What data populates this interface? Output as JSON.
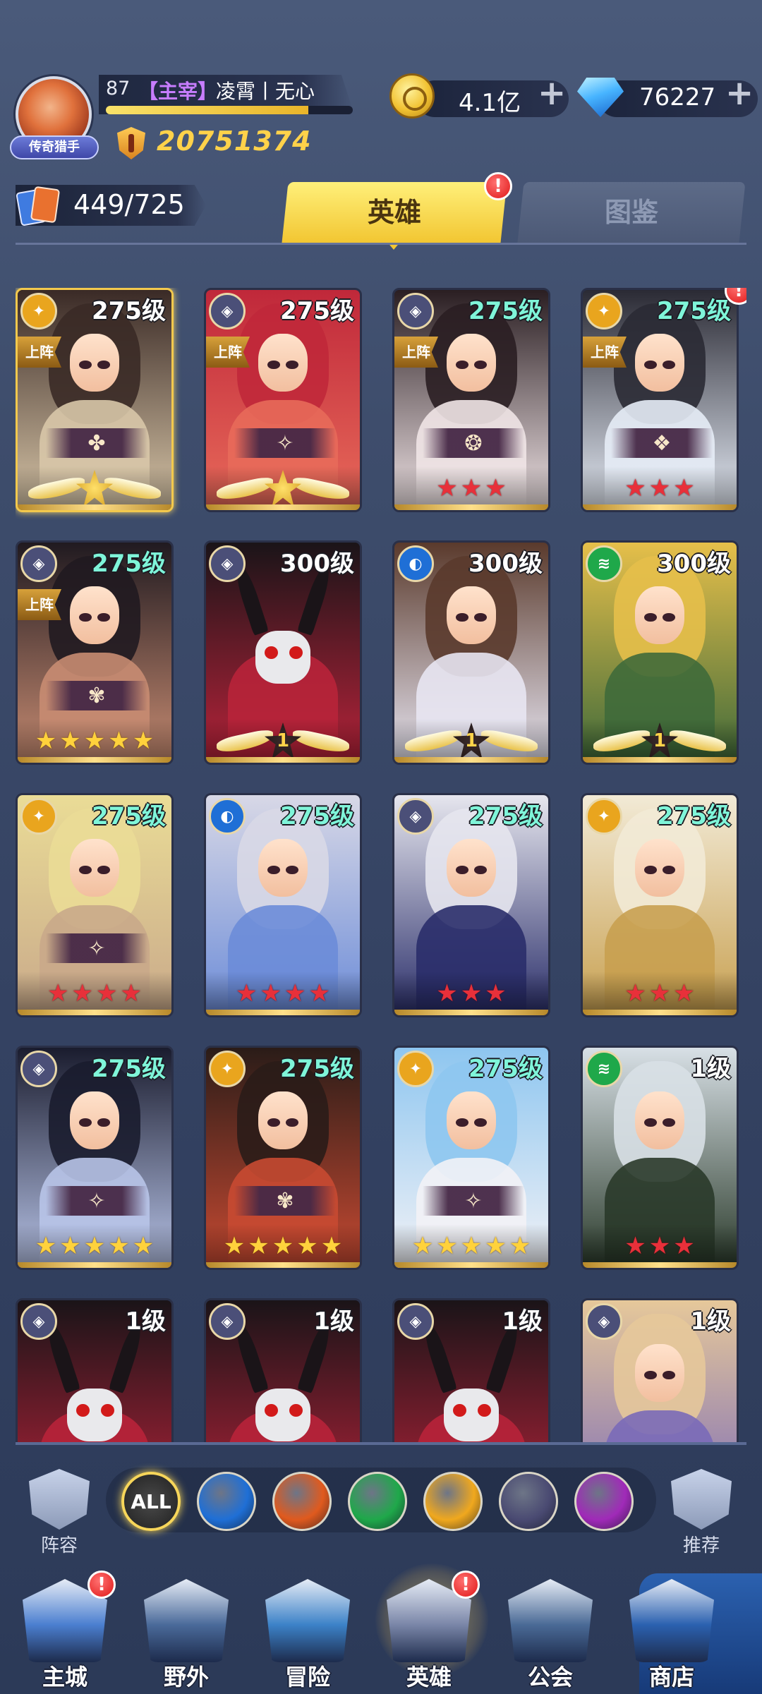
{
  "player": {
    "level": "87",
    "role": "【主宰】",
    "name": "凌霄丨无心",
    "title_badge": "传奇猎手",
    "power": "20751374",
    "exp_fraction": 0.82
  },
  "resources": {
    "gold": "4.1亿",
    "diamonds": "76227"
  },
  "collection": {
    "count": "449/725"
  },
  "tabs": {
    "heroes": "英雄",
    "codex": "图鉴",
    "alert": "!"
  },
  "heroes": [
    {
      "level": "275级",
      "faction": "light",
      "deployed": "上阵",
      "rating": "wing",
      "wing_num": "",
      "emblem": "✤",
      "level_color": "white",
      "colors": [
        "#3a2a26",
        "#d8c6a8"
      ],
      "gold_frame": true
    },
    {
      "level": "275级",
      "faction": "void",
      "deployed": "上阵",
      "rating": "wing",
      "wing_num": "",
      "emblem": "✧",
      "level_color": "white",
      "colors": [
        "#c0283a",
        "#e86a5a"
      ],
      "gold_frame": false
    },
    {
      "level": "275级",
      "faction": "void",
      "deployed": "上阵",
      "rating": "stars",
      "stars": 3,
      "star_color": "red",
      "emblem": "❂",
      "level_color": "teal",
      "colors": [
        "#2a1e22",
        "#f0e4e6"
      ],
      "gold_frame": false
    },
    {
      "level": "275级",
      "faction": "light",
      "deployed": "上阵",
      "rating": "stars",
      "stars": 3,
      "star_color": "red",
      "emblem": "❖",
      "level_color": "teal",
      "colors": [
        "#2a2a34",
        "#e6ecf6"
      ],
      "gold_frame": false,
      "alert": "!"
    },
    {
      "level": "275级",
      "faction": "void",
      "deployed": "上阵",
      "rating": "stars",
      "stars": 5,
      "star_color": "gold",
      "emblem": "✾",
      "level_color": "teal",
      "colors": [
        "#201a20",
        "#c88c72"
      ],
      "gold_frame": false
    },
    {
      "level": "300级",
      "faction": "void",
      "deployed": "",
      "rating": "wing",
      "wing_num": "1",
      "emblem": "",
      "level_color": "white",
      "colors": [
        "#1a1418",
        "#b8233a"
      ],
      "gold_frame": false,
      "monster": true
    },
    {
      "level": "300级",
      "faction": "water",
      "deployed": "",
      "rating": "wing",
      "wing_num": "1",
      "emblem": "",
      "level_color": "white",
      "colors": [
        "#5a3a2c",
        "#e8e6f2"
      ],
      "gold_frame": false
    },
    {
      "level": "300级",
      "faction": "nature",
      "deployed": "",
      "rating": "wing",
      "wing_num": "1",
      "emblem": "",
      "level_color": "white",
      "colors": [
        "#e6bf4a",
        "#3f6a3a"
      ],
      "gold_frame": false
    },
    {
      "level": "275级",
      "faction": "light",
      "deployed": "",
      "rating": "stars",
      "stars": 4,
      "star_color": "red",
      "emblem": "✧",
      "level_color": "teal",
      "colors": [
        "#eadc96",
        "#c9a98a"
      ],
      "gold_frame": false
    },
    {
      "level": "275级",
      "faction": "water",
      "deployed": "",
      "rating": "stars",
      "stars": 4,
      "star_color": "red",
      "emblem": "",
      "level_color": "teal",
      "colors": [
        "#d8d8e6",
        "#6c8cd8"
      ],
      "gold_frame": false
    },
    {
      "level": "275级",
      "faction": "void",
      "deployed": "",
      "rating": "stars",
      "stars": 3,
      "star_color": "red",
      "emblem": "",
      "level_color": "teal",
      "colors": [
        "#e6e6ee",
        "#2a2e6a"
      ],
      "gold_frame": false
    },
    {
      "level": "275级",
      "faction": "light",
      "deployed": "",
      "rating": "stars",
      "stars": 3,
      "star_color": "red",
      "emblem": "",
      "level_color": "teal",
      "colors": [
        "#f2ead6",
        "#c8a050"
      ],
      "gold_frame": false
    },
    {
      "level": "275级",
      "faction": "void",
      "deployed": "",
      "rating": "stars",
      "stars": 5,
      "star_color": "gold",
      "emblem": "✧",
      "level_color": "teal",
      "colors": [
        "#1a1c2e",
        "#b8c4e8"
      ],
      "gold_frame": false
    },
    {
      "level": "275级",
      "faction": "light",
      "deployed": "",
      "rating": "stars",
      "stars": 5,
      "star_color": "gold",
      "emblem": "✾",
      "level_color": "teal",
      "colors": [
        "#2a1c18",
        "#c84a32"
      ],
      "gold_frame": false
    },
    {
      "level": "275级",
      "faction": "light",
      "deployed": "",
      "rating": "stars",
      "stars": 5,
      "star_color": "gold",
      "emblem": "✧",
      "level_color": "teal",
      "colors": [
        "#8ec6f0",
        "#f2f2f6"
      ],
      "gold_frame": false
    },
    {
      "level": "1级",
      "faction": "nature",
      "deployed": "",
      "rating": "stars",
      "stars": 3,
      "star_color": "red",
      "emblem": "",
      "level_color": "white",
      "colors": [
        "#d8e0e6",
        "#2a3a2a"
      ],
      "gold_frame": false
    },
    {
      "level": "1级",
      "faction": "void",
      "deployed": "",
      "rating": "none",
      "emblem": "",
      "level_color": "white",
      "colors": [
        "#1a1418",
        "#b8233a"
      ],
      "gold_frame": false,
      "monster": true
    },
    {
      "level": "1级",
      "faction": "void",
      "deployed": "",
      "rating": "none",
      "emblem": "",
      "level_color": "white",
      "colors": [
        "#1a1418",
        "#b8233a"
      ],
      "gold_frame": false,
      "monster": true
    },
    {
      "level": "1级",
      "faction": "void",
      "deployed": "",
      "rating": "none",
      "emblem": "",
      "level_color": "white",
      "colors": [
        "#1a1418",
        "#b8233a"
      ],
      "gold_frame": false,
      "monster": true
    },
    {
      "level": "1级",
      "faction": "void",
      "deployed": "",
      "rating": "none",
      "emblem": "",
      "level_color": "white",
      "colors": [
        "#e6c89a",
        "#7a6ab8"
      ],
      "gold_frame": false
    }
  ],
  "filters": {
    "left_label": "阵容",
    "right_label": "推荐",
    "chips": [
      {
        "id": "all",
        "label": "ALL",
        "color": "#2a2a2a"
      },
      {
        "id": "water",
        "label": "",
        "color": "#1f6fd6"
      },
      {
        "id": "fire",
        "label": "",
        "color": "#e05a1e"
      },
      {
        "id": "nature",
        "label": "",
        "color": "#1fa84a"
      },
      {
        "id": "light",
        "label": "",
        "color": "#f0a81e"
      },
      {
        "id": "void",
        "label": "",
        "color": "#4a4a72"
      },
      {
        "id": "dark",
        "label": "",
        "color": "#a02ab8"
      }
    ]
  },
  "faction_colors": {
    "light": "#e9a51e",
    "void": "#4b4f78",
    "water": "#1f6fd6",
    "nature": "#1fa84a"
  },
  "nav": [
    {
      "id": "city",
      "label": "主城",
      "alert": "!",
      "color": "#4b7fd0"
    },
    {
      "id": "wild",
      "label": "野外",
      "alert": "",
      "color": "#4a6a9a"
    },
    {
      "id": "adventure",
      "label": "冒险",
      "alert": "",
      "color": "#3c82c8"
    },
    {
      "id": "heroes",
      "label": "英雄",
      "alert": "!",
      "color": "#7a86a8"
    },
    {
      "id": "guild",
      "label": "公会",
      "alert": "",
      "color": "#4a6a96"
    },
    {
      "id": "shop",
      "label": "商店",
      "alert": "",
      "color": "#2b61b0"
    }
  ]
}
